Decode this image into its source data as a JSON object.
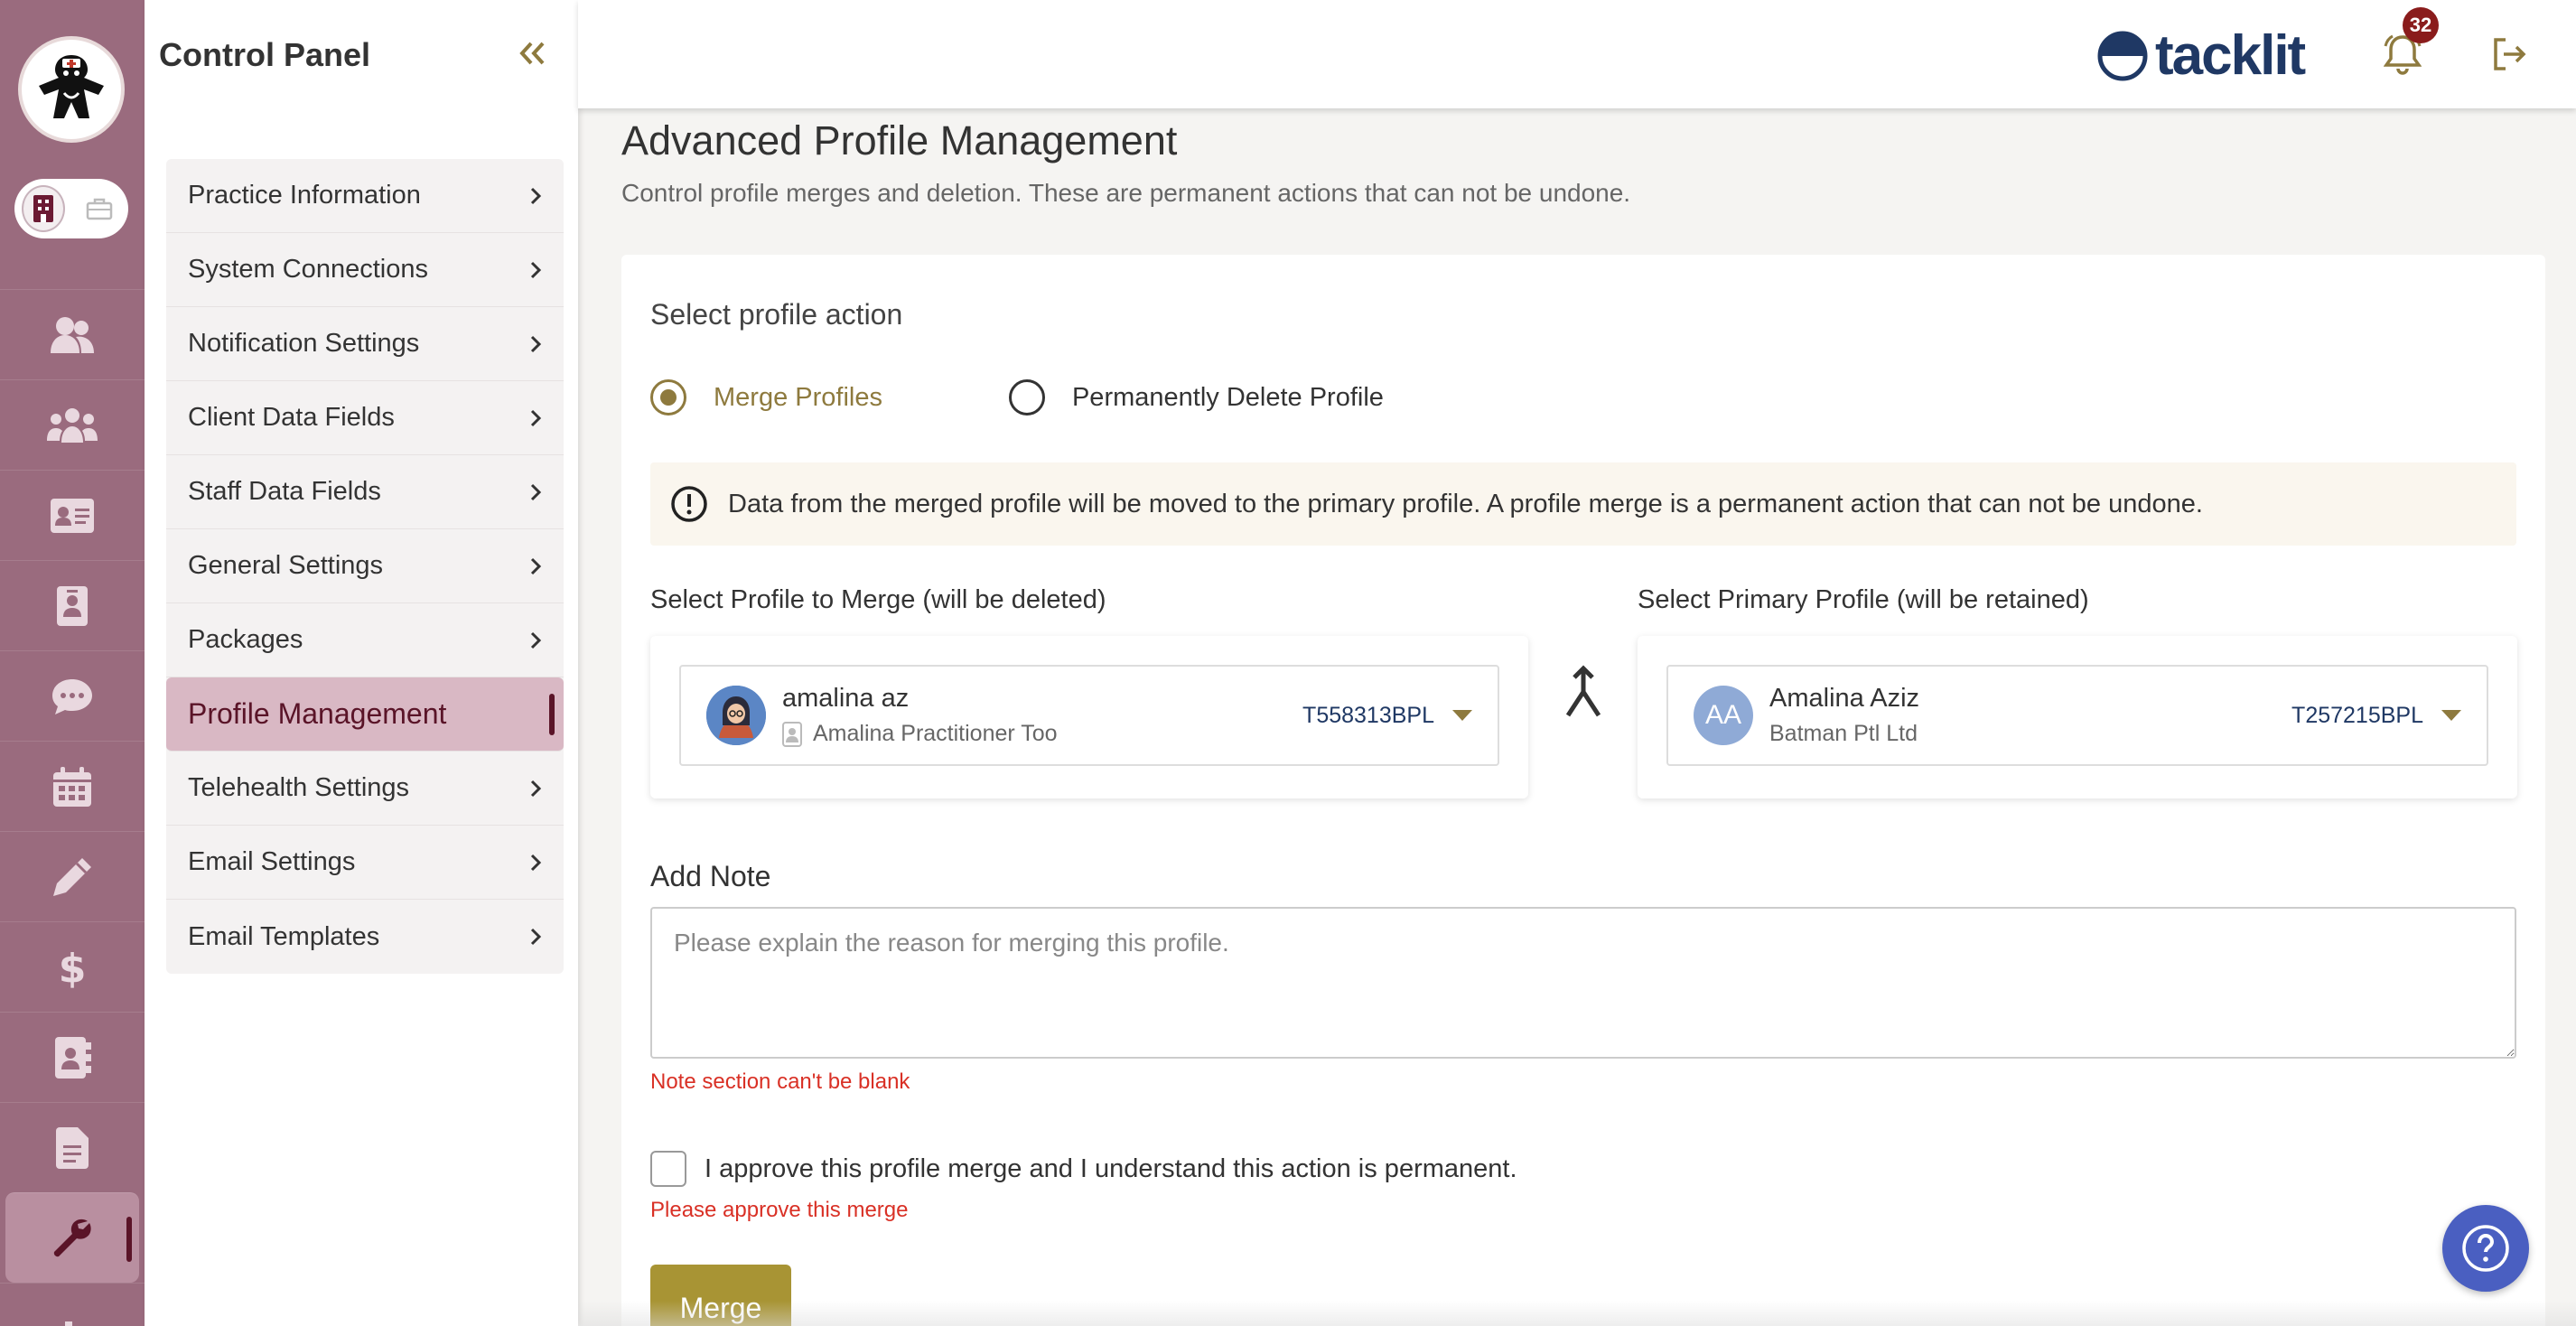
{
  "sidebar": {
    "title": "Control Panel",
    "items": [
      {
        "label": "Practice Information"
      },
      {
        "label": "System Connections"
      },
      {
        "label": "Notification Settings"
      },
      {
        "label": "Client Data Fields"
      },
      {
        "label": "Staff Data Fields"
      },
      {
        "label": "General Settings"
      },
      {
        "label": "Packages"
      },
      {
        "label": "Profile Management",
        "active": true
      },
      {
        "label": "Telehealth Settings"
      },
      {
        "label": "Email Settings"
      },
      {
        "label": "Email Templates"
      }
    ]
  },
  "rail": {
    "icons": [
      "clients-icon",
      "groups-icon",
      "id-card-icon",
      "contact-badge-icon",
      "chat-icon",
      "calendar-icon",
      "pen-icon",
      "dollar-icon",
      "address-book-icon",
      "document-icon",
      "wrench-icon",
      "chart-icon"
    ],
    "active": "wrench-icon"
  },
  "header": {
    "brand": "tacklit",
    "notification_count": "32"
  },
  "page": {
    "title": "Advanced Profile Management",
    "subtitle": "Control profile merges and deletion. These are permanent actions that can not be undone."
  },
  "action": {
    "label": "Select profile action",
    "options": [
      "Merge Profiles",
      "Permanently Delete Profile"
    ],
    "selected": "Merge Profiles"
  },
  "alert": {
    "text": "Data from the merged profile will be moved to the primary profile. A profile merge is a permanent action that can not be undone."
  },
  "merge_profile": {
    "label": "Select Profile to Merge (will be deleted)",
    "name": "amalina az",
    "practitioner": "Amalina Practitioner Too",
    "id": "T558313BPL"
  },
  "primary_profile": {
    "label": "Select Primary Profile (will be retained)",
    "initials": "AA",
    "name": "Amalina Aziz",
    "company": "Batman Ptl Ltd",
    "id": "T257215BPL"
  },
  "note": {
    "label": "Add Note",
    "placeholder": "Please explain the reason for merging this profile.",
    "error": "Note section can't be blank"
  },
  "approval": {
    "label": "I approve this profile merge and I understand this action is permanent.",
    "error": "Please approve this merge"
  },
  "merge_button": "Merge",
  "colors": {
    "rail": "#9a6b7e",
    "accent": "#8e7a3e",
    "active_item": "#d9b8c4",
    "brand": "#1f3864",
    "error": "#d93025",
    "button": "#a89434",
    "help": "#4a5fc1"
  }
}
